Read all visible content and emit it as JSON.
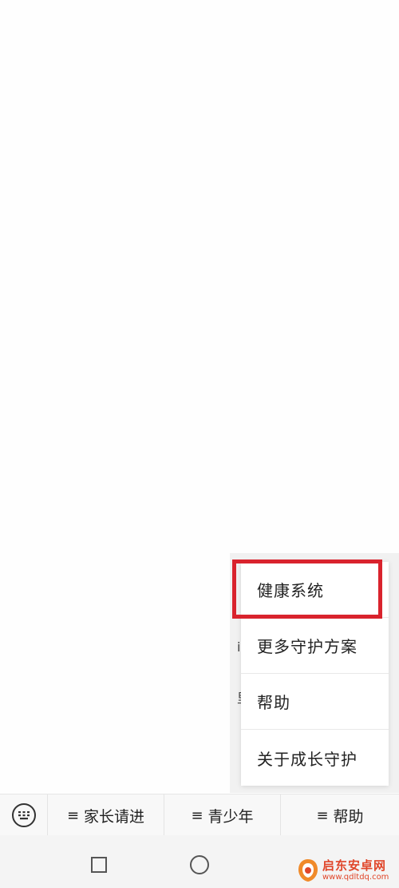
{
  "popup_menu": {
    "items": [
      {
        "label": "健康系统"
      },
      {
        "label": "更多守护方案"
      },
      {
        "label": "帮助"
      },
      {
        "label": "关于成长守护"
      }
    ],
    "highlighted_index": 0,
    "highlight_color": "#d9232d"
  },
  "bottom_menu": {
    "keyboard_icon": "keyboard-icon",
    "tabs": [
      {
        "icon": "menu-icon",
        "symbol": "≡",
        "label": "家长请进"
      },
      {
        "icon": "menu-icon",
        "symbol": "≡",
        "label": "青少年"
      },
      {
        "icon": "menu-icon",
        "symbol": "≡",
        "label": "帮助"
      }
    ]
  },
  "system_nav": {
    "recent_icon": "square-icon",
    "home_icon": "circle-icon"
  },
  "watermark": {
    "title": "启东安卓网",
    "url": "www.qdltdq.com",
    "color": "#e0462a"
  }
}
